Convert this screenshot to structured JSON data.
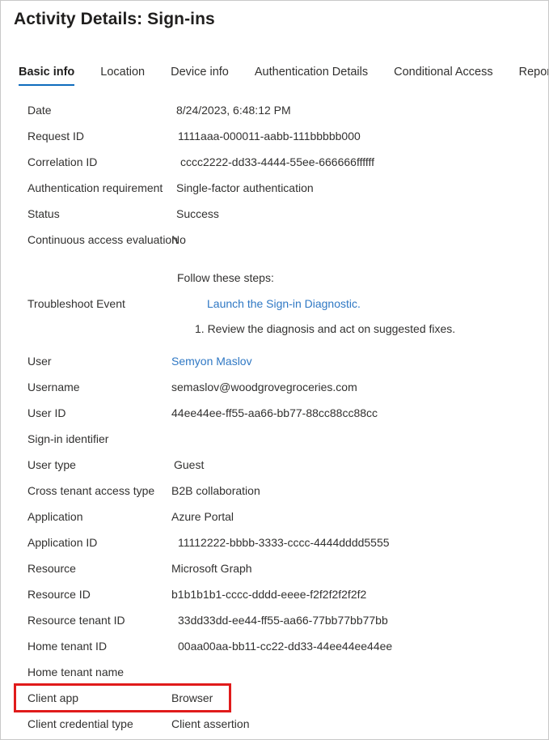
{
  "page": {
    "title": "Activity Details: Sign-ins",
    "accent_color": "#0f6cbd",
    "link_color": "#2f78c4",
    "annotation_color": "#e01b1b",
    "border_color": "#c8c8c8"
  },
  "tabs": [
    {
      "label": "Basic info",
      "selected": true
    },
    {
      "label": "Location",
      "selected": false
    },
    {
      "label": "Device info",
      "selected": false
    },
    {
      "label": "Authentication Details",
      "selected": false
    },
    {
      "label": "Conditional Access",
      "selected": false
    },
    {
      "label": "Report-only",
      "selected": false
    }
  ],
  "rows_top": [
    {
      "label": "Date",
      "value": "8/24/2023, 6:48:12 PM"
    },
    {
      "label": "Request ID",
      "value": "1111aaa-000011-aabb-111bbbbb000"
    },
    {
      "label": "Correlation ID",
      "value": "cccc2222-dd33-4444-55ee-666666ffffff"
    },
    {
      "label": "Authentication requirement",
      "value": "Single-factor authentication"
    },
    {
      "label": "Status",
      "value": "Success"
    },
    {
      "label": "Continuous access evaluation",
      "value": "No"
    }
  ],
  "troubleshoot": {
    "label": "Troubleshoot Event",
    "intro": "Follow these steps:",
    "link": "Launch the Sign-in Diagnostic.",
    "step": "1. Review the diagnosis and act on suggested fixes."
  },
  "rows_bottom": [
    {
      "label": "User",
      "value": "Semyon Maslov",
      "link": true
    },
    {
      "label": "Username",
      "value": "semaslov@woodgrovegroceries.com"
    },
    {
      "label": "User ID",
      "value": "44ee44ee-ff55-aa66-bb77-88cc88cc88cc"
    },
    {
      "label": "Sign-in identifier",
      "value": ""
    },
    {
      "label": "User type",
      "value": "Guest"
    },
    {
      "label": "Cross tenant access type",
      "value": "B2B collaboration"
    },
    {
      "label": "Application",
      "value": "Azure Portal"
    },
    {
      "label": "Application ID",
      "value": "11112222-bbbb-3333-cccc-4444dddd5555"
    },
    {
      "label": "Resource",
      "value": "Microsoft Graph"
    },
    {
      "label": "Resource ID",
      "value": "b1b1b1b1-cccc-dddd-eeee-f2f2f2f2f2f2"
    },
    {
      "label": "Resource tenant ID",
      "value": "33dd33dd-ee44-ff55-aa66-77bb77bb77bb"
    },
    {
      "label": "Home tenant ID",
      "value": "00aa00aa-bb11-cc22-dd33-44ee44ee44ee"
    },
    {
      "label": "Home tenant name",
      "value": ""
    },
    {
      "label": "Client app",
      "value": "Browser",
      "highlighted": true
    },
    {
      "label": "Client credential type",
      "value": "Client assertion"
    }
  ]
}
